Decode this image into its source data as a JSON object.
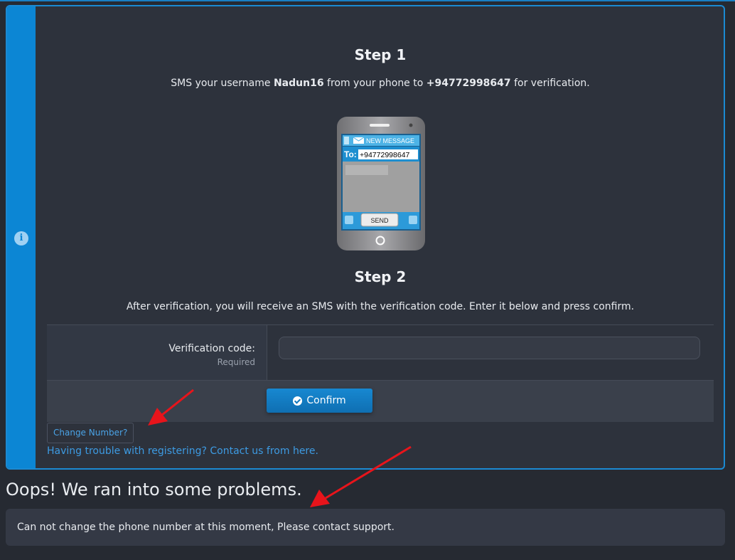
{
  "step1": {
    "title": "Step 1",
    "text_prefix": "SMS your username ",
    "username": "Nadun16",
    "text_middle": " from your phone to ",
    "phone_number": "+94772998647",
    "text_suffix": " for verification."
  },
  "phone_graphic": {
    "header": "NEW MESSAGE",
    "to_label": "To:",
    "to_value": "+94772998647",
    "send_label": "SEND"
  },
  "step2": {
    "title": "Step 2",
    "text": "After verification, you will receive an SMS with the verification code. Enter it below and press confirm."
  },
  "form": {
    "code_label": "Verification code:",
    "required_label": "Required",
    "code_value": "",
    "confirm_label": "Confirm"
  },
  "links": {
    "change_number": "Change Number?",
    "help": "Having trouble with registering? Contact us from here."
  },
  "error": {
    "title": "Oops! We ran into some problems.",
    "message": "Can not change the phone number at this moment, Please contact support."
  },
  "colors": {
    "accent": "#0c86d4",
    "link": "#3d9be3",
    "annotation_arrow": "#e8141b"
  },
  "icons": [
    "info-icon",
    "check-circle-icon",
    "envelope-icon"
  ]
}
